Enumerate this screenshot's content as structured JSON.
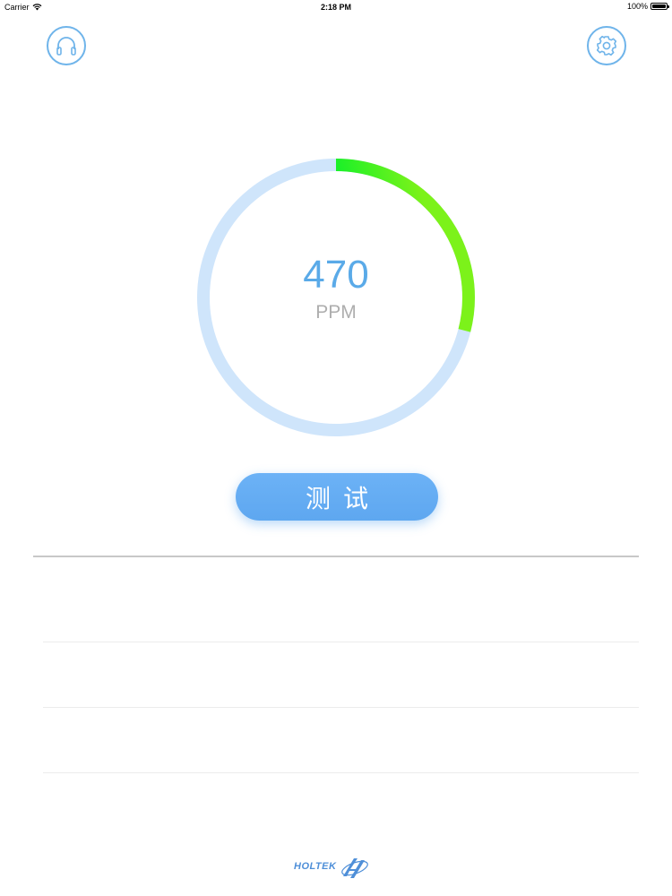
{
  "status_bar": {
    "carrier": "Carrier",
    "time": "2:18 PM",
    "battery": "100%"
  },
  "icons": {
    "headset": "headphones-icon",
    "settings": "gear-icon",
    "wifi": "wifi-icon"
  },
  "gauge": {
    "value": "470",
    "unit": "PPM",
    "fill_fraction": 0.29
  },
  "test_button": {
    "label": "测试"
  },
  "logo": {
    "text": "HOLTEK"
  },
  "colors": {
    "accent_blue": "#5aaae8",
    "track": "#cfe5fb",
    "gradient_start": "#5aaae8",
    "gradient_mid": "#2ed26a",
    "gradient_end": "#7cf21a",
    "button": "#62abf3"
  }
}
